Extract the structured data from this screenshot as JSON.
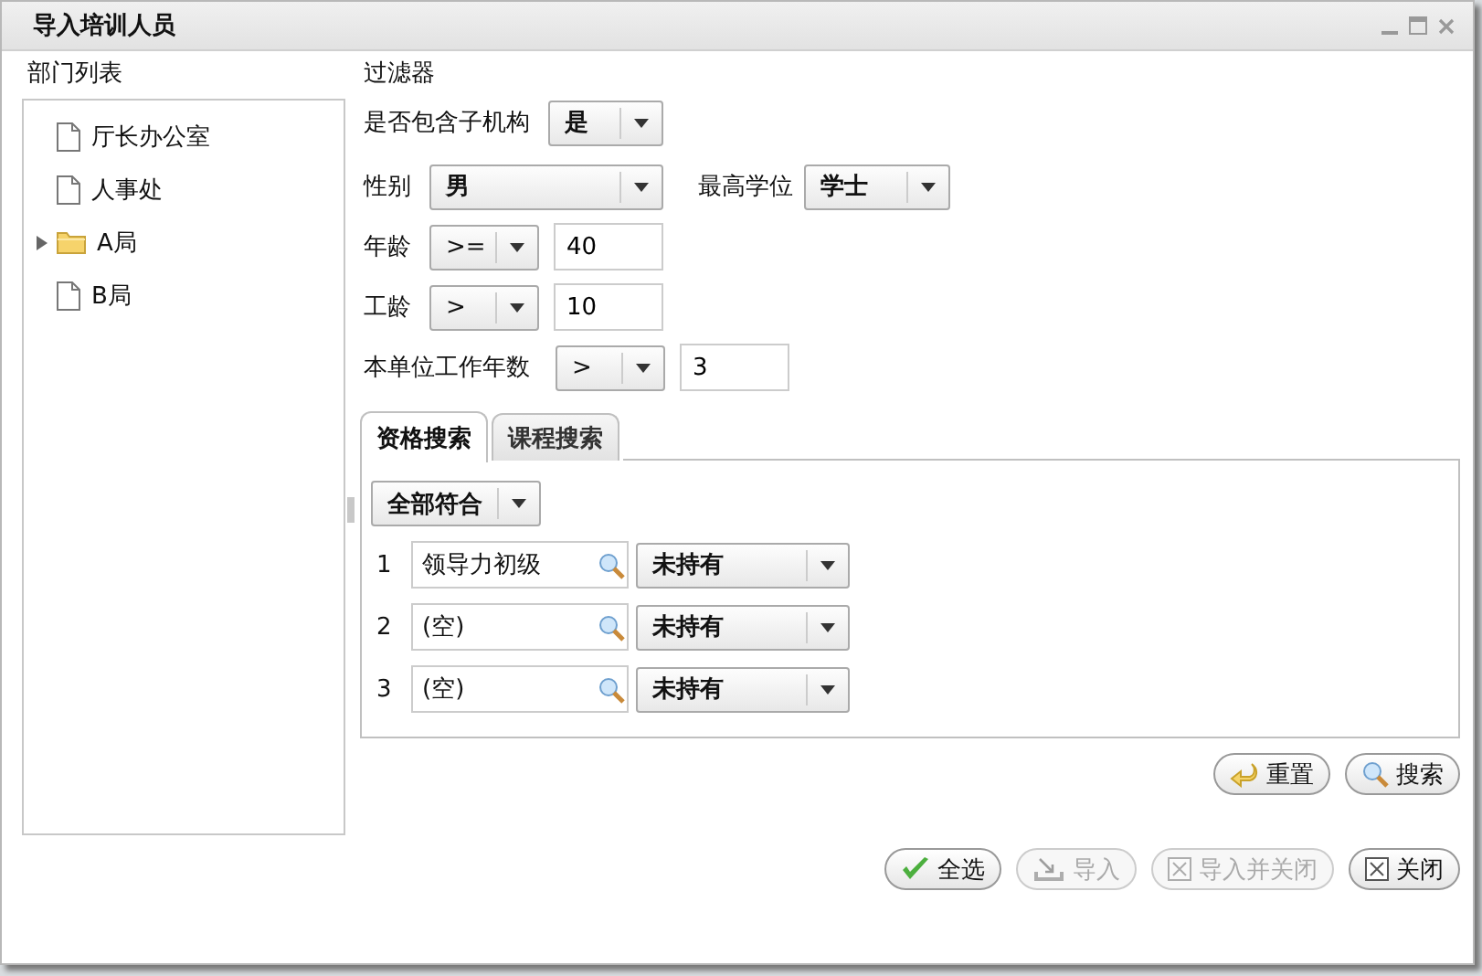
{
  "window": {
    "title": "导入培训人员"
  },
  "department_list": {
    "label": "部门列表",
    "items": [
      {
        "label": "厅长办公室",
        "kind": "leaf"
      },
      {
        "label": "人事处",
        "kind": "leaf"
      },
      {
        "label": "A局",
        "kind": "folder",
        "expanded": false
      },
      {
        "label": "B局",
        "kind": "leaf"
      }
    ]
  },
  "filter": {
    "label": "过滤器",
    "include_sub": {
      "label": "是否包含子机构",
      "value": "是"
    },
    "gender": {
      "label": "性别",
      "value": "男"
    },
    "degree": {
      "label": "最高学位",
      "value": "学士"
    },
    "age": {
      "label": "年龄",
      "operator": ">=",
      "value": "40"
    },
    "seniority": {
      "label": "工龄",
      "operator": ">",
      "value": "10"
    },
    "unit_years": {
      "label": "本单位工作年数",
      "operator": ">",
      "value": "3"
    }
  },
  "tabs": [
    {
      "label": "资格搜索",
      "selected": true
    },
    {
      "label": "课程搜索",
      "selected": false
    }
  ],
  "match_mode": "全部符合",
  "criteria": [
    {
      "number": "1",
      "value": "领导力初级",
      "status": "未持有"
    },
    {
      "number": "2",
      "value": "(空)",
      "status": "未持有"
    },
    {
      "number": "3",
      "value": "(空)",
      "status": "未持有"
    }
  ],
  "search_buttons": [
    {
      "label": "重置",
      "kind": "reset",
      "disabled": false
    },
    {
      "label": "搜索",
      "kind": "search",
      "disabled": false
    }
  ],
  "buttons": [
    {
      "label": "全选",
      "kind": "check",
      "disabled": false
    },
    {
      "label": "导入",
      "kind": "import",
      "disabled": true
    },
    {
      "label": "导入并关闭",
      "kind": "closebox",
      "disabled": true
    },
    {
      "label": "关闭",
      "kind": "closebox",
      "disabled": false
    }
  ]
}
